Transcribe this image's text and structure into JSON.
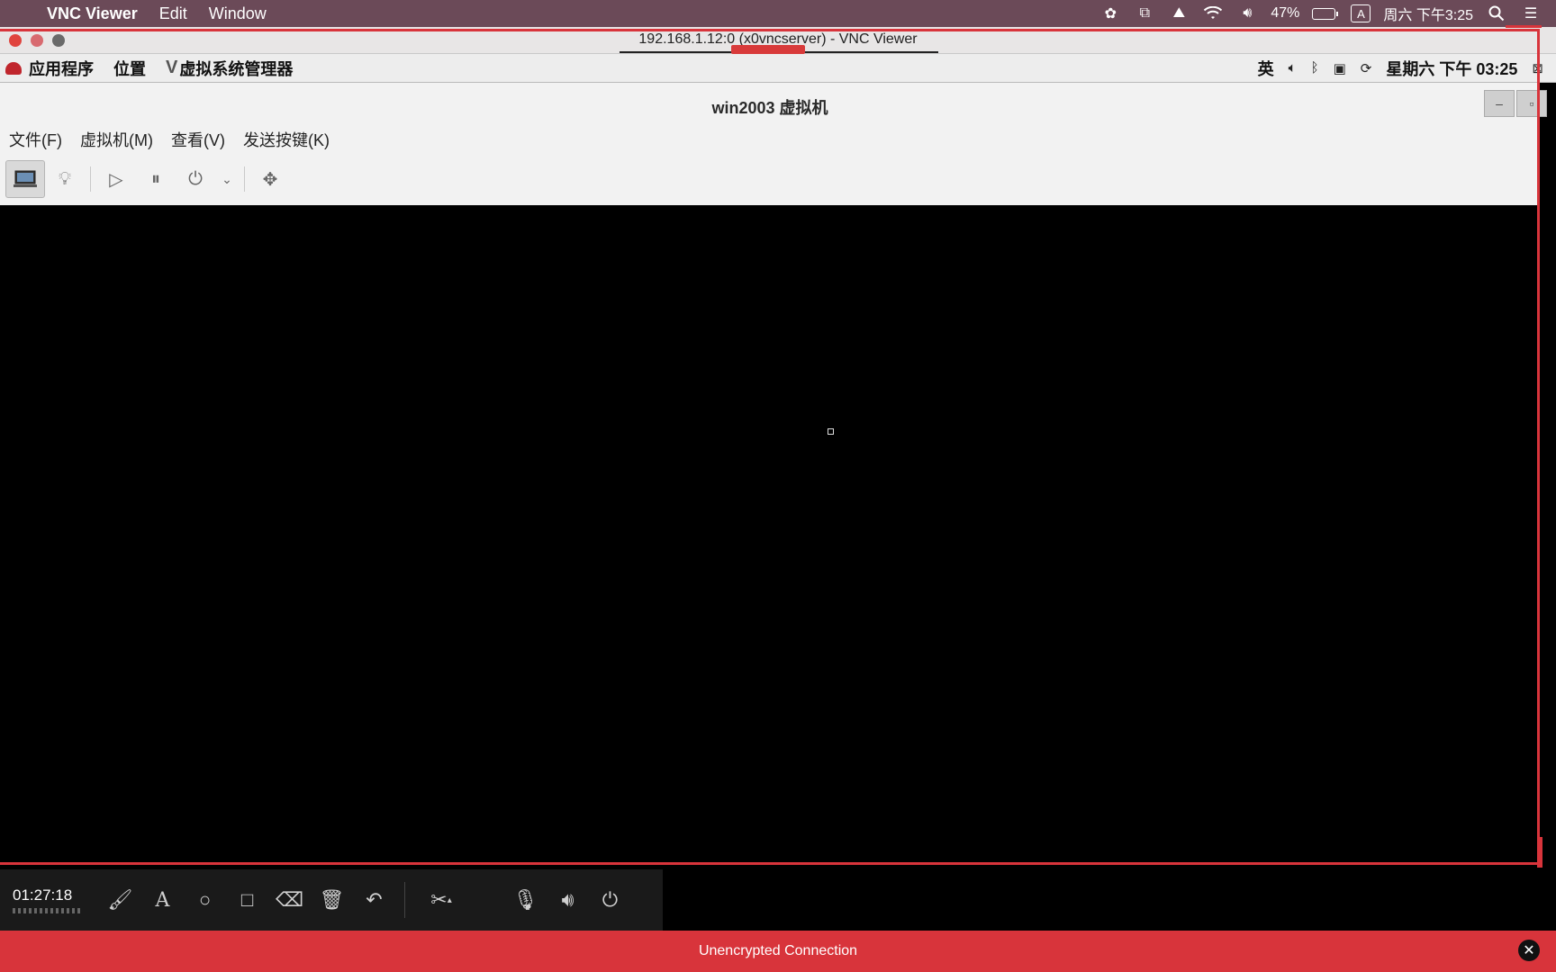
{
  "mac_menubar": {
    "app_name": "VNC Viewer",
    "menus": [
      "Edit",
      "Window"
    ],
    "battery_percent": "47%",
    "battery_level": 0.47,
    "input_source": "A",
    "clock": "周六 下午3:25"
  },
  "vnc_window": {
    "title": "192.168.1.12:0 (x0vncserver) - VNC Viewer"
  },
  "remote_panel": {
    "menus": [
      "应用程序",
      "位置",
      "虚拟系统管理器"
    ],
    "ime": "英",
    "datetime": "星期六 下午 03:25"
  },
  "vm_window": {
    "title": "win2003 虚拟机",
    "menus": [
      "文件(F)",
      "虚拟机(M)",
      "查看(V)",
      "发送按键(K)"
    ]
  },
  "recorder": {
    "elapsed": "01:27:18"
  },
  "banner": {
    "text": "Unencrypted Connection"
  },
  "colors": {
    "menubar_bg": "#6b4a58",
    "accent_red": "#d8343b",
    "console_bg": "#000000"
  }
}
